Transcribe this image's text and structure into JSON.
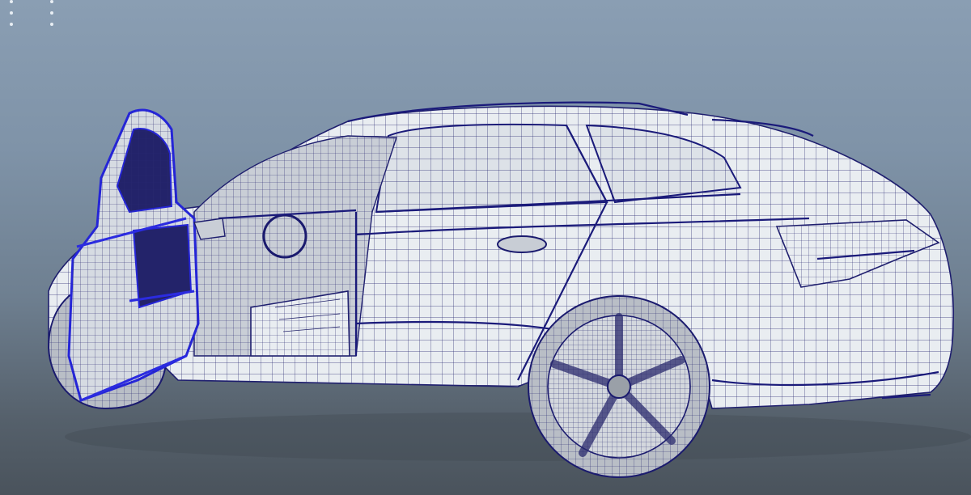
{
  "viewport": {
    "background_top": "#8a9eb3",
    "background_bottom": "#4a535c",
    "mesh_color": "#23236b",
    "selection_color": "#2b2be0",
    "surface_color": "#e9edf1"
  },
  "model": {
    "type": "wireframe-car-mesh",
    "icon": "car-wireframe-icon"
  }
}
